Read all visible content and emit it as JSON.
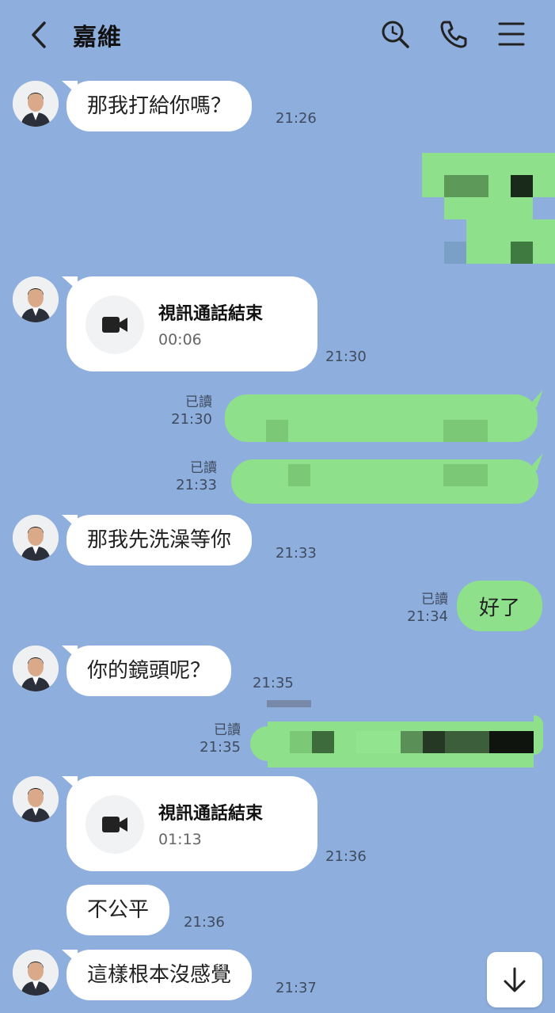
{
  "header": {
    "title": "嘉維"
  },
  "icons": {
    "back": "chevron-left-icon",
    "search": "search-icon",
    "call": "phone-icon",
    "menu": "menu-icon",
    "scroll": "arrow-down-icon"
  },
  "messages": {
    "m1": {
      "text": "那我打給你嗎？",
      "time": "21:26"
    },
    "m2": {
      "title": "視訊通話結束",
      "duration": "00:06",
      "time": "21:30"
    },
    "m3": {
      "read": "已讀",
      "time": "21:30"
    },
    "m4": {
      "read": "已讀",
      "time": "21:33"
    },
    "m5": {
      "text": "那我先洗澡等你",
      "time": "21:33"
    },
    "m6": {
      "read": "已讀",
      "time": "21:34",
      "text": "好了"
    },
    "m7": {
      "text": "你的鏡頭呢？",
      "time": "21:35"
    },
    "m8": {
      "read": "已讀",
      "time": "21:35"
    },
    "m9": {
      "title": "視訊通話結束",
      "duration": "01:13",
      "time": "21:36"
    },
    "m10": {
      "text": "不公平",
      "time": "21:36"
    },
    "m11": {
      "text": "這樣根本沒感覺",
      "time": "21:37"
    }
  }
}
